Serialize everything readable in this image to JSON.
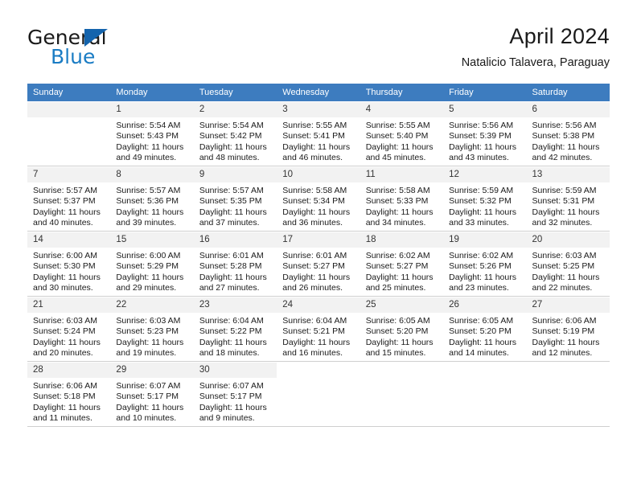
{
  "brand": {
    "name_part1": "General",
    "name_part2": "Blue",
    "triangle_color": "#1464ad",
    "blue_color": "#1a7cc4"
  },
  "header": {
    "title": "April 2024",
    "subtitle": "Natalicio Talavera, Paraguay"
  },
  "theme": {
    "header_row_bg": "#3d7cbf",
    "header_row_text": "#ffffff",
    "daynum_bg": "#f2f2f2",
    "grid_line": "#cfcfcf"
  },
  "weekdays": [
    "Sunday",
    "Monday",
    "Tuesday",
    "Wednesday",
    "Thursday",
    "Friday",
    "Saturday"
  ],
  "weeks": [
    [
      {
        "day": "",
        "sunrise": "",
        "sunset": "",
        "daylight1": "",
        "daylight2": "",
        "blank": true
      },
      {
        "day": "1",
        "sunrise": "Sunrise: 5:54 AM",
        "sunset": "Sunset: 5:43 PM",
        "daylight1": "Daylight: 11 hours",
        "daylight2": "and 49 minutes."
      },
      {
        "day": "2",
        "sunrise": "Sunrise: 5:54 AM",
        "sunset": "Sunset: 5:42 PM",
        "daylight1": "Daylight: 11 hours",
        "daylight2": "and 48 minutes."
      },
      {
        "day": "3",
        "sunrise": "Sunrise: 5:55 AM",
        "sunset": "Sunset: 5:41 PM",
        "daylight1": "Daylight: 11 hours",
        "daylight2": "and 46 minutes."
      },
      {
        "day": "4",
        "sunrise": "Sunrise: 5:55 AM",
        "sunset": "Sunset: 5:40 PM",
        "daylight1": "Daylight: 11 hours",
        "daylight2": "and 45 minutes."
      },
      {
        "day": "5",
        "sunrise": "Sunrise: 5:56 AM",
        "sunset": "Sunset: 5:39 PM",
        "daylight1": "Daylight: 11 hours",
        "daylight2": "and 43 minutes."
      },
      {
        "day": "6",
        "sunrise": "Sunrise: 5:56 AM",
        "sunset": "Sunset: 5:38 PM",
        "daylight1": "Daylight: 11 hours",
        "daylight2": "and 42 minutes."
      }
    ],
    [
      {
        "day": "7",
        "sunrise": "Sunrise: 5:57 AM",
        "sunset": "Sunset: 5:37 PM",
        "daylight1": "Daylight: 11 hours",
        "daylight2": "and 40 minutes."
      },
      {
        "day": "8",
        "sunrise": "Sunrise: 5:57 AM",
        "sunset": "Sunset: 5:36 PM",
        "daylight1": "Daylight: 11 hours",
        "daylight2": "and 39 minutes."
      },
      {
        "day": "9",
        "sunrise": "Sunrise: 5:57 AM",
        "sunset": "Sunset: 5:35 PM",
        "daylight1": "Daylight: 11 hours",
        "daylight2": "and 37 minutes."
      },
      {
        "day": "10",
        "sunrise": "Sunrise: 5:58 AM",
        "sunset": "Sunset: 5:34 PM",
        "daylight1": "Daylight: 11 hours",
        "daylight2": "and 36 minutes."
      },
      {
        "day": "11",
        "sunrise": "Sunrise: 5:58 AM",
        "sunset": "Sunset: 5:33 PM",
        "daylight1": "Daylight: 11 hours",
        "daylight2": "and 34 minutes."
      },
      {
        "day": "12",
        "sunrise": "Sunrise: 5:59 AM",
        "sunset": "Sunset: 5:32 PM",
        "daylight1": "Daylight: 11 hours",
        "daylight2": "and 33 minutes."
      },
      {
        "day": "13",
        "sunrise": "Sunrise: 5:59 AM",
        "sunset": "Sunset: 5:31 PM",
        "daylight1": "Daylight: 11 hours",
        "daylight2": "and 32 minutes."
      }
    ],
    [
      {
        "day": "14",
        "sunrise": "Sunrise: 6:00 AM",
        "sunset": "Sunset: 5:30 PM",
        "daylight1": "Daylight: 11 hours",
        "daylight2": "and 30 minutes."
      },
      {
        "day": "15",
        "sunrise": "Sunrise: 6:00 AM",
        "sunset": "Sunset: 5:29 PM",
        "daylight1": "Daylight: 11 hours",
        "daylight2": "and 29 minutes."
      },
      {
        "day": "16",
        "sunrise": "Sunrise: 6:01 AM",
        "sunset": "Sunset: 5:28 PM",
        "daylight1": "Daylight: 11 hours",
        "daylight2": "and 27 minutes."
      },
      {
        "day": "17",
        "sunrise": "Sunrise: 6:01 AM",
        "sunset": "Sunset: 5:27 PM",
        "daylight1": "Daylight: 11 hours",
        "daylight2": "and 26 minutes."
      },
      {
        "day": "18",
        "sunrise": "Sunrise: 6:02 AM",
        "sunset": "Sunset: 5:27 PM",
        "daylight1": "Daylight: 11 hours",
        "daylight2": "and 25 minutes."
      },
      {
        "day": "19",
        "sunrise": "Sunrise: 6:02 AM",
        "sunset": "Sunset: 5:26 PM",
        "daylight1": "Daylight: 11 hours",
        "daylight2": "and 23 minutes."
      },
      {
        "day": "20",
        "sunrise": "Sunrise: 6:03 AM",
        "sunset": "Sunset: 5:25 PM",
        "daylight1": "Daylight: 11 hours",
        "daylight2": "and 22 minutes."
      }
    ],
    [
      {
        "day": "21",
        "sunrise": "Sunrise: 6:03 AM",
        "sunset": "Sunset: 5:24 PM",
        "daylight1": "Daylight: 11 hours",
        "daylight2": "and 20 minutes."
      },
      {
        "day": "22",
        "sunrise": "Sunrise: 6:03 AM",
        "sunset": "Sunset: 5:23 PM",
        "daylight1": "Daylight: 11 hours",
        "daylight2": "and 19 minutes."
      },
      {
        "day": "23",
        "sunrise": "Sunrise: 6:04 AM",
        "sunset": "Sunset: 5:22 PM",
        "daylight1": "Daylight: 11 hours",
        "daylight2": "and 18 minutes."
      },
      {
        "day": "24",
        "sunrise": "Sunrise: 6:04 AM",
        "sunset": "Sunset: 5:21 PM",
        "daylight1": "Daylight: 11 hours",
        "daylight2": "and 16 minutes."
      },
      {
        "day": "25",
        "sunrise": "Sunrise: 6:05 AM",
        "sunset": "Sunset: 5:20 PM",
        "daylight1": "Daylight: 11 hours",
        "daylight2": "and 15 minutes."
      },
      {
        "day": "26",
        "sunrise": "Sunrise: 6:05 AM",
        "sunset": "Sunset: 5:20 PM",
        "daylight1": "Daylight: 11 hours",
        "daylight2": "and 14 minutes."
      },
      {
        "day": "27",
        "sunrise": "Sunrise: 6:06 AM",
        "sunset": "Sunset: 5:19 PM",
        "daylight1": "Daylight: 11 hours",
        "daylight2": "and 12 minutes."
      }
    ],
    [
      {
        "day": "28",
        "sunrise": "Sunrise: 6:06 AM",
        "sunset": "Sunset: 5:18 PM",
        "daylight1": "Daylight: 11 hours",
        "daylight2": "and 11 minutes."
      },
      {
        "day": "29",
        "sunrise": "Sunrise: 6:07 AM",
        "sunset": "Sunset: 5:17 PM",
        "daylight1": "Daylight: 11 hours",
        "daylight2": "and 10 minutes."
      },
      {
        "day": "30",
        "sunrise": "Sunrise: 6:07 AM",
        "sunset": "Sunset: 5:17 PM",
        "daylight1": "Daylight: 11 hours",
        "daylight2": "and 9 minutes."
      },
      {
        "day": "",
        "sunrise": "",
        "sunset": "",
        "daylight1": "",
        "daylight2": "",
        "blank": true,
        "nofill": true
      },
      {
        "day": "",
        "sunrise": "",
        "sunset": "",
        "daylight1": "",
        "daylight2": "",
        "blank": true,
        "nofill": true
      },
      {
        "day": "",
        "sunrise": "",
        "sunset": "",
        "daylight1": "",
        "daylight2": "",
        "blank": true,
        "nofill": true
      },
      {
        "day": "",
        "sunrise": "",
        "sunset": "",
        "daylight1": "",
        "daylight2": "",
        "blank": true,
        "nofill": true
      }
    ]
  ]
}
